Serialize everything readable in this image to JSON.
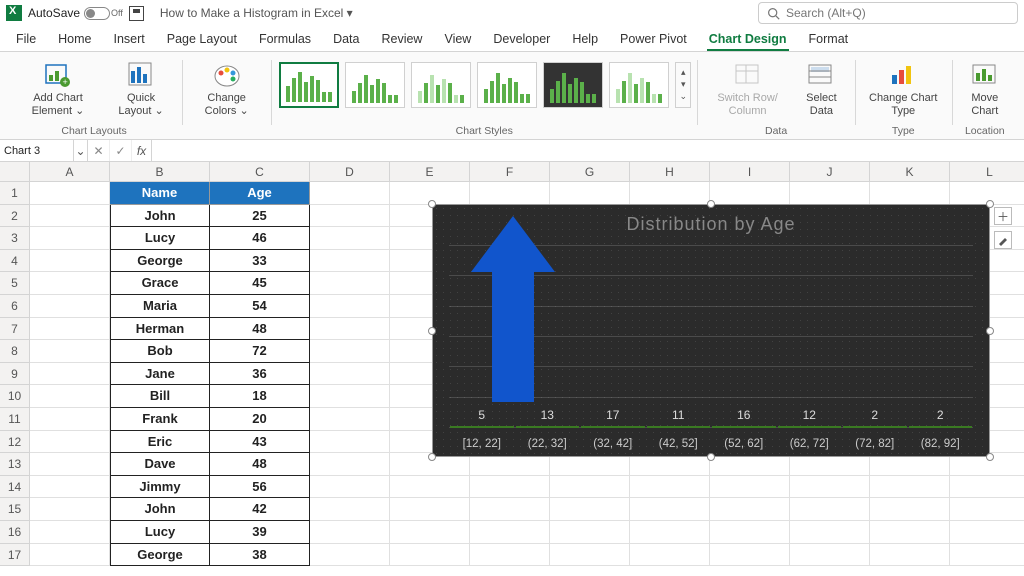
{
  "titlebar": {
    "autosave": "AutoSave",
    "toggle_state": "Off",
    "doc_title": "How to Make a Histogram in Excel  ▾",
    "search_placeholder": "Search (Alt+Q)"
  },
  "menu": [
    "File",
    "Home",
    "Insert",
    "Page Layout",
    "Formulas",
    "Data",
    "Review",
    "View",
    "Developer",
    "Help",
    "Power Pivot",
    "Chart Design",
    "Format"
  ],
  "menu_active": 11,
  "ribbon": {
    "layouts_group": "Chart Layouts",
    "add_elem": "Add Chart Element ⌄",
    "quick": "Quick Layout ⌄",
    "colors": "Change Colors ⌄",
    "styles_group": "Chart Styles",
    "switch": "Switch Row/ Column",
    "select": "Select Data",
    "data_group": "Data",
    "change_type": "Change Chart Type",
    "type_group": "Type",
    "move": "Move Chart",
    "loc_group": "Location"
  },
  "namebox": "Chart 3",
  "fx": "fx",
  "cols": [
    "A",
    "B",
    "C",
    "D",
    "E",
    "F",
    "G",
    "H",
    "I",
    "J",
    "K",
    "L"
  ],
  "table": {
    "headers": [
      "Name",
      "Age"
    ],
    "rows": [
      [
        "John",
        "25"
      ],
      [
        "Lucy",
        "46"
      ],
      [
        "George",
        "33"
      ],
      [
        "Grace",
        "45"
      ],
      [
        "Maria",
        "54"
      ],
      [
        "Herman",
        "48"
      ],
      [
        "Bob",
        "72"
      ],
      [
        "Jane",
        "36"
      ],
      [
        "Bill",
        "18"
      ],
      [
        "Frank",
        "20"
      ],
      [
        "Eric",
        "43"
      ],
      [
        "Dave",
        "48"
      ],
      [
        "Jimmy",
        "56"
      ],
      [
        "John",
        "42"
      ],
      [
        "Lucy",
        "39"
      ],
      [
        "George",
        "38"
      ]
    ]
  },
  "chart_data": {
    "type": "bar",
    "title": "Distribution by Age",
    "categories": [
      "[12, 22]",
      "(22, 32]",
      "(32, 42]",
      "(42, 52]",
      "(52, 62]",
      "(62, 72]",
      "(72, 82]",
      "(82, 92]"
    ],
    "values": [
      5,
      13,
      17,
      11,
      16,
      12,
      2,
      2
    ],
    "ylim": [
      0,
      18
    ],
    "xlabel": "",
    "ylabel": ""
  }
}
